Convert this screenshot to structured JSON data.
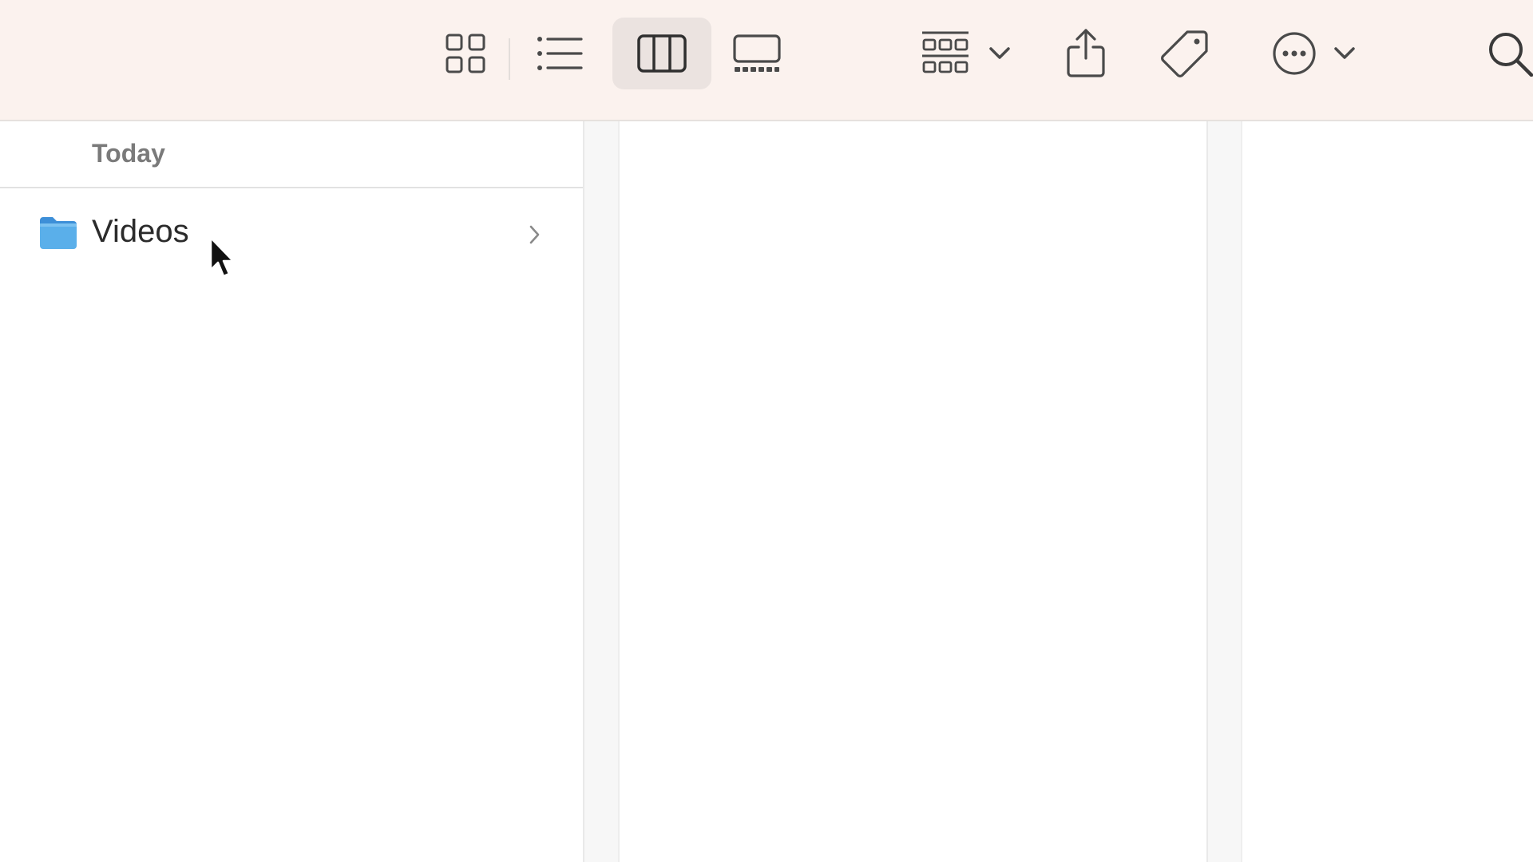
{
  "toolbar": {
    "view_buttons": [
      {
        "name": "icon-view",
        "icon": "grid-icon"
      },
      {
        "name": "list-view",
        "icon": "list-icon"
      },
      {
        "name": "column-view",
        "icon": "columns-icon",
        "selected": true
      },
      {
        "name": "gallery-view",
        "icon": "gallery-icon"
      }
    ],
    "group_button": {
      "icon": "group-grid-icon",
      "menu": "chevron-down-icon"
    },
    "share_button": {
      "icon": "share-icon"
    },
    "tag_button": {
      "icon": "tag-icon"
    },
    "more_button": {
      "icon": "ellipsis-circle-icon",
      "menu": "chevron-down-icon"
    },
    "search_button": {
      "icon": "search-icon"
    }
  },
  "columns": [
    {
      "section_title": "Today",
      "items": [
        {
          "label": "Videos",
          "icon": "folder-icon",
          "has_children": true
        }
      ]
    },
    {
      "items": []
    },
    {
      "items": []
    }
  ],
  "colors": {
    "toolbar_bg": "#fbf2ee",
    "folder_blue": "#5aafea",
    "selected_button_bg": "#ebe3e0"
  }
}
